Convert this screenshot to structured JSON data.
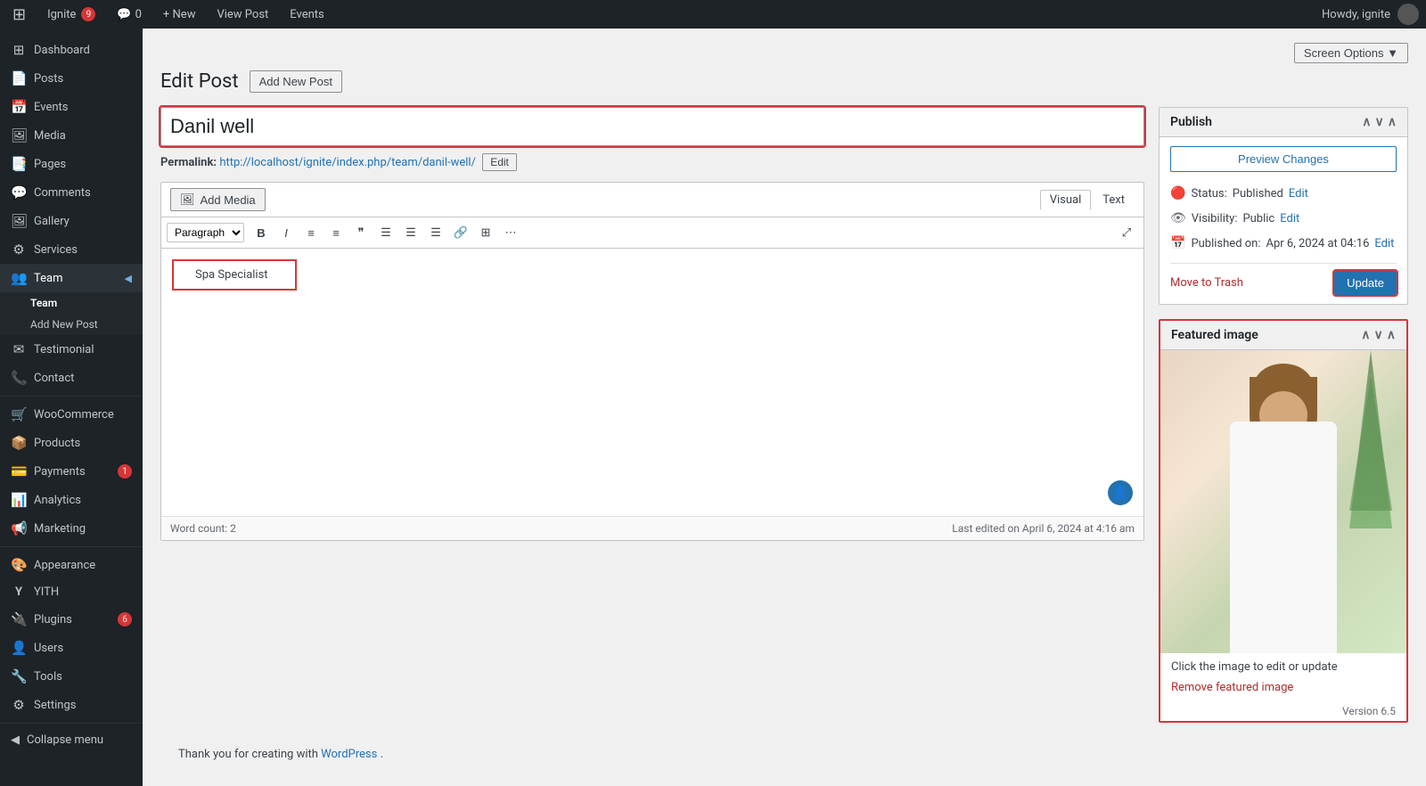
{
  "adminbar": {
    "site_name": "Ignite",
    "notif_count": "9",
    "comment_count": "0",
    "new_label": "+ New",
    "view_post_label": "View Post",
    "events_label": "Events",
    "howdy": "Howdy, ignite"
  },
  "screen_options": {
    "label": "Screen Options ▼"
  },
  "page": {
    "title": "Edit Post",
    "add_new_label": "Add New Post"
  },
  "post": {
    "title": "Danil well",
    "permalink_label": "Permalink:",
    "permalink_url": "http://localhost/ignite/index.php/team/danil-well/",
    "edit_label": "Edit",
    "content": "Spa Specialist",
    "word_count": "Word count: 2",
    "last_edited": "Last edited on April 6, 2024 at 4:16 am"
  },
  "editor": {
    "add_media_label": "Add Media",
    "visual_label": "Visual",
    "text_label": "Text",
    "format_default": "Paragraph",
    "bold_symbol": "B",
    "italic_symbol": "I"
  },
  "publish_box": {
    "title": "Publish",
    "preview_changes_label": "Preview Changes",
    "status_label": "Status:",
    "status_value": "Published",
    "status_edit": "Edit",
    "visibility_label": "Visibility:",
    "visibility_value": "Public",
    "visibility_edit": "Edit",
    "published_label": "Published on:",
    "published_value": "Apr 6, 2024 at 04:16",
    "published_edit": "Edit",
    "move_trash_label": "Move to Trash",
    "update_label": "Update"
  },
  "featured_image_box": {
    "title": "Featured image",
    "caption": "Click the image to edit or update",
    "remove_label": "Remove featured image",
    "version": "Version 6.5"
  },
  "sidebar": {
    "items": [
      {
        "id": "dashboard",
        "label": "Dashboard",
        "icon": "⊞"
      },
      {
        "id": "posts",
        "label": "Posts",
        "icon": "📄"
      },
      {
        "id": "events",
        "label": "Events",
        "icon": "📅"
      },
      {
        "id": "media",
        "label": "Media",
        "icon": "🖼"
      },
      {
        "id": "pages",
        "label": "Pages",
        "icon": "📑"
      },
      {
        "id": "comments",
        "label": "Comments",
        "icon": "💬"
      },
      {
        "id": "gallery",
        "label": "Gallery",
        "icon": "🖼"
      },
      {
        "id": "services",
        "label": "Services",
        "icon": "⚙"
      },
      {
        "id": "team",
        "label": "Team",
        "icon": "👥"
      },
      {
        "id": "testimonial",
        "label": "Testimonial",
        "icon": "✉"
      },
      {
        "id": "contact",
        "label": "Contact",
        "icon": "📞"
      },
      {
        "id": "woocommerce",
        "label": "WooCommerce",
        "icon": "🛒"
      },
      {
        "id": "products",
        "label": "Products",
        "icon": "📦"
      },
      {
        "id": "payments",
        "label": "Payments",
        "icon": "💳",
        "badge": "1"
      },
      {
        "id": "analytics",
        "label": "Analytics",
        "icon": "📊"
      },
      {
        "id": "marketing",
        "label": "Marketing",
        "icon": "📢"
      },
      {
        "id": "appearance",
        "label": "Appearance",
        "icon": "🎨"
      },
      {
        "id": "yith",
        "label": "YITH",
        "icon": "Y"
      },
      {
        "id": "plugins",
        "label": "Plugins",
        "icon": "🔌",
        "badge": "6"
      },
      {
        "id": "users",
        "label": "Users",
        "icon": "👤"
      },
      {
        "id": "tools",
        "label": "Tools",
        "icon": "🔧"
      },
      {
        "id": "settings",
        "label": "Settings",
        "icon": "⚙"
      }
    ],
    "submenu": {
      "team": [
        {
          "id": "team-all",
          "label": "Team"
        },
        {
          "id": "team-add",
          "label": "Add New Post"
        }
      ]
    },
    "collapse_label": "Collapse menu"
  },
  "footer": {
    "thanks": "Thank you for creating with",
    "wordpress": "WordPress",
    "period": "."
  }
}
